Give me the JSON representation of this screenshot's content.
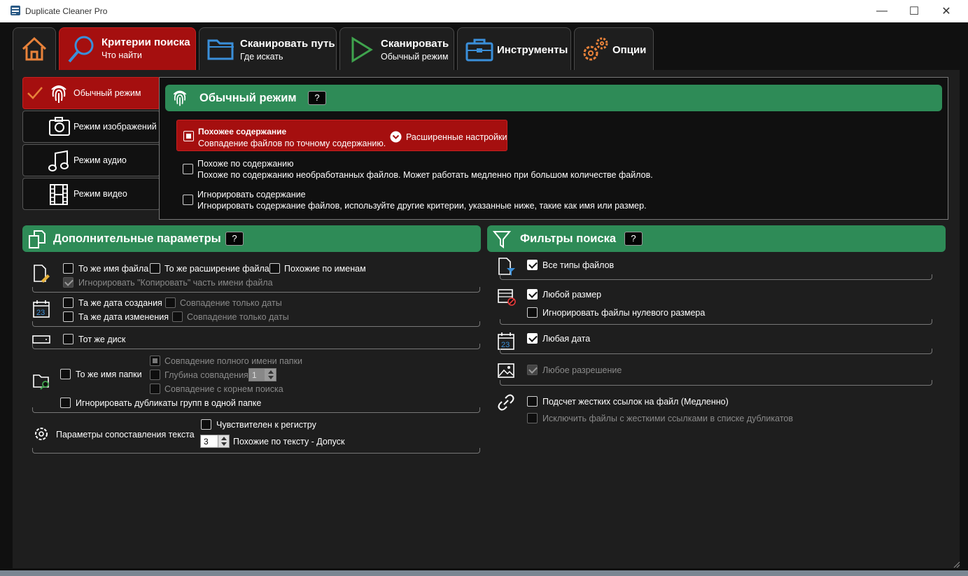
{
  "window": {
    "title": "Duplicate Cleaner Pro"
  },
  "tabs": [
    {
      "title": "Критерии поиска",
      "subtitle": "Что найти"
    },
    {
      "title": "Сканировать путь",
      "subtitle": "Где искать"
    },
    {
      "title": "Сканировать",
      "subtitle": "Обычный режим"
    },
    {
      "title": "Инструменты"
    },
    {
      "title": "Опции"
    }
  ],
  "modes": [
    {
      "label": "Обычный режим"
    },
    {
      "label": "Режим изображений"
    },
    {
      "label": "Режим аудио"
    },
    {
      "label": "Режим видео"
    }
  ],
  "normal_mode": {
    "title": "Обычный режим",
    "help": "?",
    "options": [
      {
        "title": "Похожее содержание",
        "desc": "Совпадение файлов по точному содержанию."
      },
      {
        "title": "Похоже по содержанию",
        "desc": "Похоже по содержанию необработанных файлов. Может работать медленно при большом количестве файлов."
      },
      {
        "title": "Игнорировать содержание",
        "desc": "Игнорировать содержание файлов, используйте другие критерии, указанные ниже, такие как имя или размер."
      }
    ],
    "advanced_label": "Расширенные настройки"
  },
  "extra": {
    "title": "Дополнительные параметры",
    "help": "?",
    "same_name": "То же имя файла",
    "same_ext": "То же расширение файла",
    "similar_names": "Похожие по именам",
    "ignore_copy": "Игнорировать \"Копировать\" часть имени файла",
    "same_created": "Та же дата создания",
    "date_only_1": "Совпадение только даты",
    "same_modified": "Та же дата изменения",
    "date_only_2": "Совпадение только даты",
    "same_disk": "Тот же диск",
    "same_folder": "То же имя папки",
    "full_folder": "Совпадение полного имени папки",
    "match_depth": "Глубина совпадения",
    "depth_value": "1",
    "root_match": "Совпадение с корнем поиска",
    "ignore_group": "Игнорировать дубликаты групп в одной папке",
    "text_params": "Параметры сопоставления текста",
    "case_sensitive": "Чувствителен к регистру",
    "tolerance_value": "3",
    "tolerance_label": "Похожие по тексту - Допуск"
  },
  "filters": {
    "title": "Фильтры поиска",
    "help": "?",
    "all_types": "Все типы файлов",
    "any_size": "Любой размер",
    "ignore_zero": "Игнорировать файлы нулевого размера",
    "any_date": "Любая дата",
    "any_resolution": "Любое разрешение",
    "hardlinks": "Подсчет жестких ссылок на файл (Медленно)",
    "exclude_hardlinks": "Исключить файлы с жесткими ссылками в списке дубликатов"
  },
  "colors": {
    "accent_red": "#a50f0f",
    "banner_green": "#2e8b57",
    "icon_orange": "#e8823a",
    "icon_blue": "#3a8fd9",
    "icon_green": "#3fa34d"
  }
}
